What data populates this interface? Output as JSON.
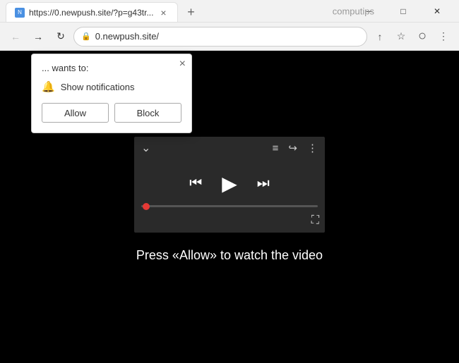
{
  "titlebar": {
    "brand": "computips",
    "tab": {
      "title": "https://0.newpush.site/?p=g43tr...",
      "favicon": "N"
    },
    "new_tab_label": "+",
    "window_controls": {
      "minimize": "─",
      "maximize": "□",
      "close": "✕"
    }
  },
  "toolbar": {
    "back": "←",
    "forward": "→",
    "refresh": "↻",
    "address": "0.newpush.site/",
    "lock_icon": "🔒",
    "bookmark_icon": "☆",
    "share_icon": "↑",
    "profile_icon": "○",
    "menu_icon": "⋮"
  },
  "notification_popup": {
    "header": "... wants to:",
    "close_icon": "×",
    "bell_icon": "🔔",
    "notification_text": "Show notifications",
    "allow_label": "Allow",
    "block_label": "Block"
  },
  "video_player": {
    "chevron_down": "⌄",
    "playlist_icon": "≡→",
    "share_icon": "↪",
    "more_icon": "⋮",
    "prev_icon": "⏮",
    "play_icon": "▶",
    "next_icon": "⏭",
    "fullscreen_icon": "⛶"
  },
  "main": {
    "instruction": "Press «Allow» to watch the video"
  }
}
